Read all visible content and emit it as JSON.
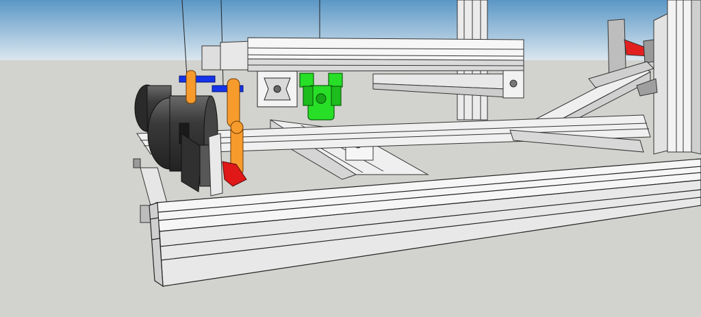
{
  "scene": {
    "colors": {
      "sky_top": "#5f9bc8",
      "sky_bottom": "#d8e6ef",
      "ground": "#d1d1cd",
      "extrusion_light": "#f7f7f7",
      "extrusion_mid": "#e3e3e3",
      "extrusion_dark": "#c9c9c9",
      "outline": "#2a2a2a",
      "orange_part": "#f59a2b",
      "blue_part": "#1330e8",
      "green_part": "#22e022",
      "red_part": "#e01818",
      "motor_body": "#3b3b3b",
      "motor_highlight": "#6c6c6c"
    }
  }
}
